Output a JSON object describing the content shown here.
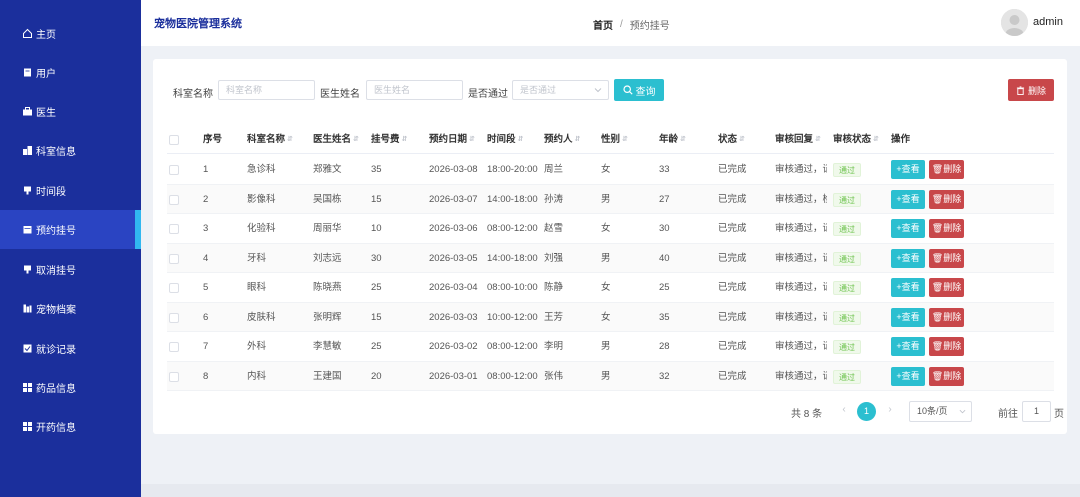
{
  "app": {
    "title": "宠物医院管理系统"
  },
  "breadcrumb": {
    "home": "首页",
    "separator": "/",
    "current": "预约挂号"
  },
  "user": {
    "name": "admin"
  },
  "sidebar": {
    "items": [
      {
        "label": "主页",
        "icon": "home-icon"
      },
      {
        "label": "用户",
        "icon": "file-icon"
      },
      {
        "label": "医生",
        "icon": "briefcase-icon"
      },
      {
        "label": "科室信息",
        "icon": "building-icon"
      },
      {
        "label": "时间段",
        "icon": "clock-icon"
      },
      {
        "label": "预约挂号",
        "icon": "calendar-icon",
        "active": true
      },
      {
        "label": "取消挂号",
        "icon": "cancel-icon"
      },
      {
        "label": "宠物档案",
        "icon": "archive-icon"
      },
      {
        "label": "就诊记录",
        "icon": "record-icon"
      },
      {
        "label": "药品信息",
        "icon": "grid-icon"
      },
      {
        "label": "开药信息",
        "icon": "grid-icon"
      }
    ]
  },
  "filters": {
    "dept_label": "科室名称",
    "dept_placeholder": "科室名称",
    "doctor_label": "医生姓名",
    "doctor_placeholder": "医生姓名",
    "passed_label": "是否通过",
    "passed_placeholder": "是否通过",
    "query_label": "查询",
    "delete_label": "删除"
  },
  "table": {
    "headers": [
      "序号",
      "科室名称",
      "医生姓名",
      "挂号费",
      "预约日期",
      "时间段",
      "预约人",
      "性别",
      "年龄",
      "状态",
      "审核回复",
      "审核状态",
      "操作"
    ],
    "view_label": "查看",
    "delete_label": "删除",
    "rows": [
      {
        "no": "1",
        "dept": "急诊科",
        "doctor": "郑雅文",
        "fee": "35",
        "date": "2026-03-08",
        "time": "18:00-20:00",
        "person": "周兰",
        "gender": "女",
        "age": "33",
        "status": "已完成",
        "reply": "审核通过，请",
        "audit": "通过"
      },
      {
        "no": "2",
        "dept": "影像科",
        "doctor": "吴国栋",
        "fee": "15",
        "date": "2026-03-07",
        "time": "14:00-18:00",
        "person": "孙涛",
        "gender": "男",
        "age": "27",
        "status": "已完成",
        "reply": "审核通过，检",
        "audit": "通过"
      },
      {
        "no": "3",
        "dept": "化验科",
        "doctor": "周丽华",
        "fee": "10",
        "date": "2026-03-06",
        "time": "08:00-12:00",
        "person": "赵雪",
        "gender": "女",
        "age": "30",
        "status": "已完成",
        "reply": "审核通过，请",
        "audit": "通过"
      },
      {
        "no": "4",
        "dept": "牙科",
        "doctor": "刘志远",
        "fee": "30",
        "date": "2026-03-05",
        "time": "14:00-18:00",
        "person": "刘强",
        "gender": "男",
        "age": "40",
        "status": "已完成",
        "reply": "审核通过，请",
        "audit": "通过"
      },
      {
        "no": "5",
        "dept": "眼科",
        "doctor": "陈晓燕",
        "fee": "25",
        "date": "2026-03-04",
        "time": "08:00-10:00",
        "person": "陈静",
        "gender": "女",
        "age": "25",
        "status": "已完成",
        "reply": "审核通过，请",
        "audit": "通过"
      },
      {
        "no": "6",
        "dept": "皮肤科",
        "doctor": "张明辉",
        "fee": "15",
        "date": "2026-03-03",
        "time": "10:00-12:00",
        "person": "王芳",
        "gender": "女",
        "age": "35",
        "status": "已完成",
        "reply": "审核通过，请",
        "audit": "通过"
      },
      {
        "no": "7",
        "dept": "外科",
        "doctor": "李慧敏",
        "fee": "25",
        "date": "2026-03-02",
        "time": "08:00-12:00",
        "person": "李明",
        "gender": "男",
        "age": "28",
        "status": "已完成",
        "reply": "审核通过，请",
        "audit": "通过"
      },
      {
        "no": "8",
        "dept": "内科",
        "doctor": "王建国",
        "fee": "20",
        "date": "2026-03-01",
        "time": "08:00-12:00",
        "person": "张伟",
        "gender": "男",
        "age": "32",
        "status": "已完成",
        "reply": "审核通过，请",
        "audit": "通过"
      }
    ]
  },
  "pagination": {
    "total": "共 8 条",
    "current_page": "1",
    "page_size": "10条/页",
    "goto_label": "前往",
    "goto_value": "1",
    "goto_unit": "页"
  },
  "colors": {
    "sidebar": "#1b2f9c",
    "accent": "#2bbfd0",
    "danger": "#c8474a",
    "success": "#6bc24b"
  }
}
